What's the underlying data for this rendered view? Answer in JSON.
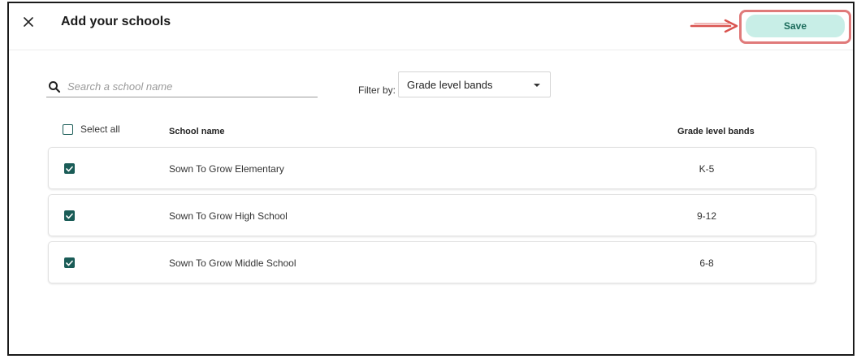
{
  "dialog": {
    "title": "Add your schools",
    "save_label": "Save"
  },
  "search": {
    "placeholder": "Search a school name",
    "value": ""
  },
  "filter": {
    "label": "Filter by:",
    "selected": "Grade level bands"
  },
  "table": {
    "select_all_label": "Select all",
    "columns": [
      "School name",
      "Grade level bands"
    ],
    "rows": [
      {
        "name": "Sown To Grow Elementary",
        "grade": "K-5",
        "checked": true
      },
      {
        "name": "Sown To Grow High School",
        "grade": "9-12",
        "checked": true
      },
      {
        "name": "Sown To Grow Middle School",
        "grade": "6-8",
        "checked": true
      }
    ]
  },
  "colors": {
    "accent": "#1a5c57",
    "save_bg": "#c8eee7",
    "highlight": "#e07a7a"
  },
  "icons": [
    "close-icon",
    "search-icon",
    "caret-down-icon",
    "checkbox-checked-icon",
    "checkbox-empty-icon",
    "arrow-annotation-icon"
  ]
}
